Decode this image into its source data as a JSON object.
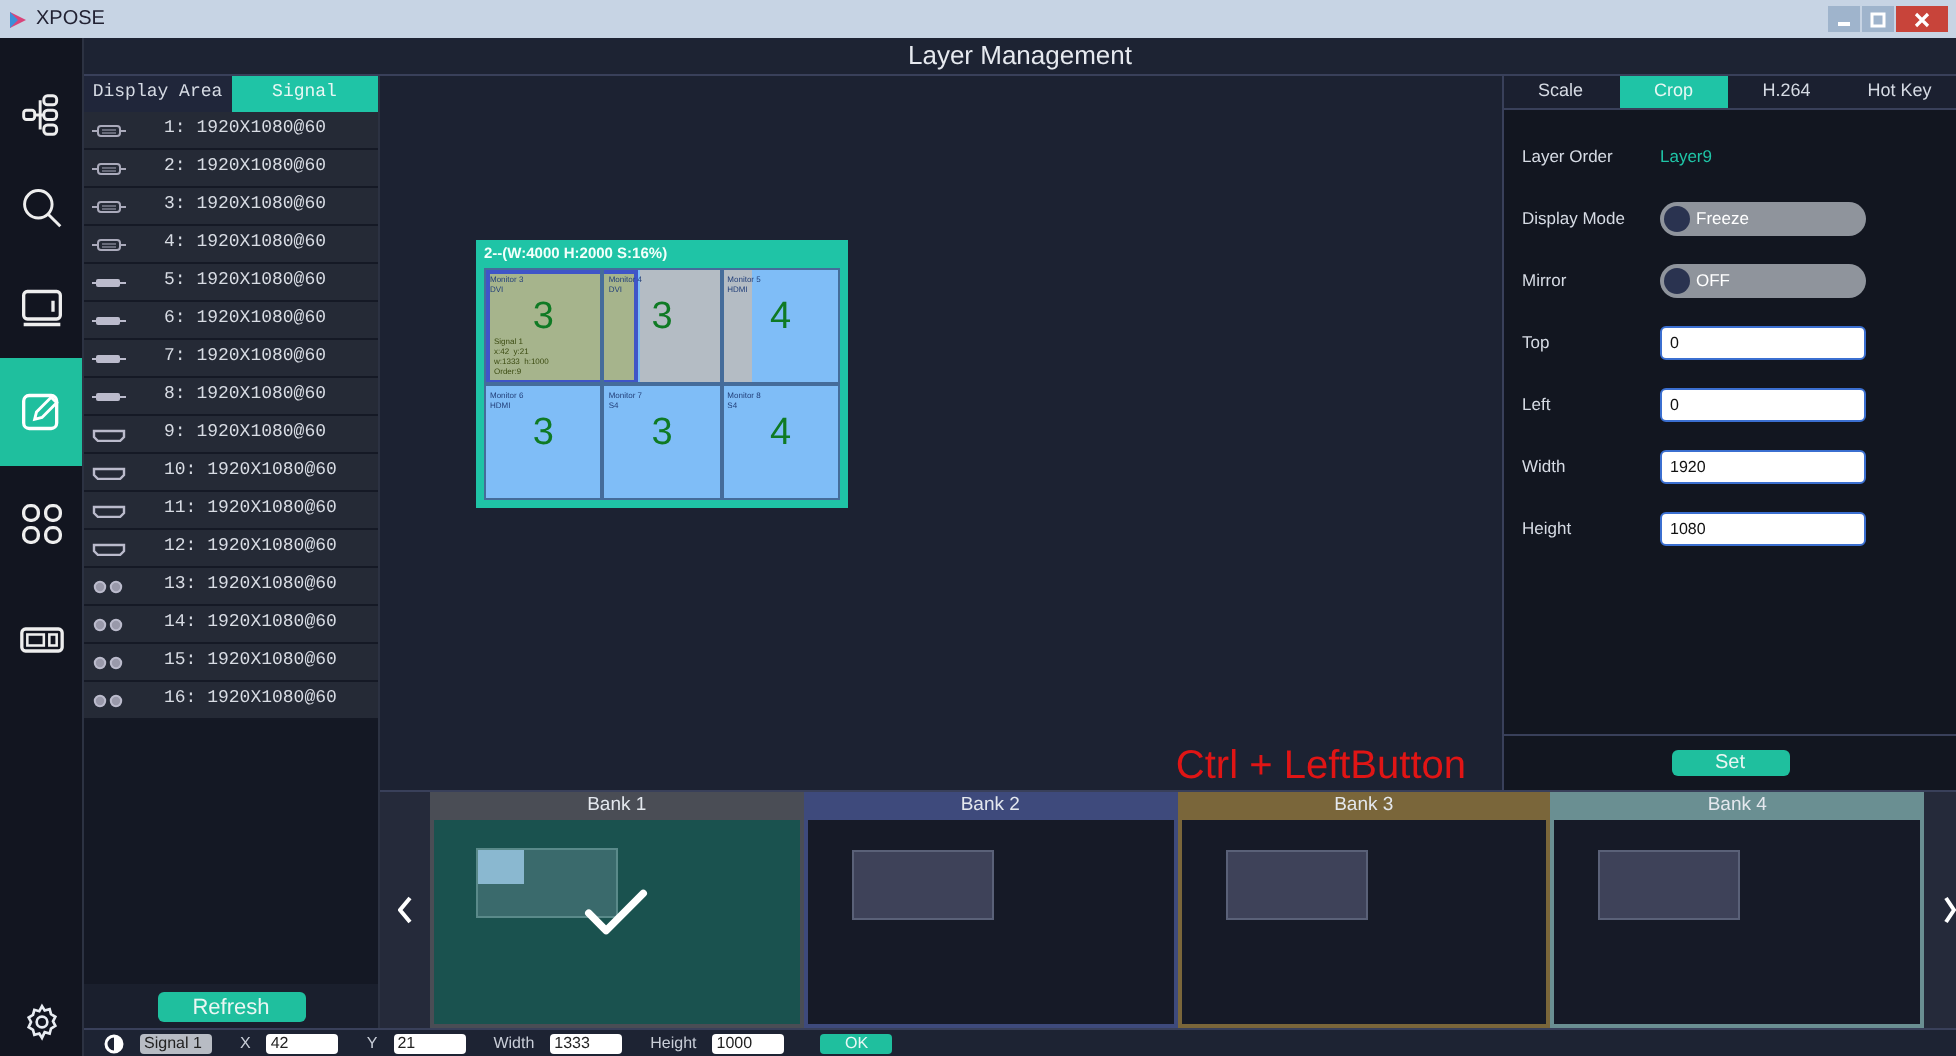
{
  "window": {
    "title": "XPOSE"
  },
  "nav": [
    {
      "kind": "tree",
      "selected": false
    },
    {
      "kind": "search",
      "selected": false
    },
    {
      "kind": "monitor",
      "selected": false
    },
    {
      "kind": "edit",
      "selected": true
    },
    {
      "kind": "grid",
      "selected": false
    },
    {
      "kind": "display",
      "selected": false
    }
  ],
  "header": "Layer Management",
  "signal_panel": {
    "tabs": [
      {
        "label": "Display Area",
        "selected": false
      },
      {
        "label": "Signal",
        "selected": true
      }
    ],
    "signals": [
      {
        "kind": "vga",
        "label": "1: 1920X1080@60"
      },
      {
        "kind": "vga",
        "label": "2: 1920X1080@60"
      },
      {
        "kind": "vga",
        "label": "3: 1920X1080@60"
      },
      {
        "kind": "vga",
        "label": "4: 1920X1080@60"
      },
      {
        "kind": "dvi",
        "label": "5: 1920X1080@60"
      },
      {
        "kind": "dvi",
        "label": "6: 1920X1080@60"
      },
      {
        "kind": "dvi",
        "label": "7: 1920X1080@60"
      },
      {
        "kind": "dvi",
        "label": "8: 1920X1080@60"
      },
      {
        "kind": "hdmi",
        "label": "9: 1920X1080@60"
      },
      {
        "kind": "hdmi",
        "label": "10: 1920X1080@60"
      },
      {
        "kind": "hdmi",
        "label": "11: 1920X1080@60"
      },
      {
        "kind": "hdmi",
        "label": "12: 1920X1080@60"
      },
      {
        "kind": "dual",
        "label": "13: 1920X1080@60"
      },
      {
        "kind": "dual",
        "label": "14: 1920X1080@60"
      },
      {
        "kind": "dual",
        "label": "15: 1920X1080@60"
      },
      {
        "kind": "dual",
        "label": "16: 1920X1080@60"
      }
    ],
    "refresh_button": "Refresh"
  },
  "screen": {
    "title": "2--(W:4000 H:2000 S:16%)",
    "cells": [
      {
        "monitor": "Monitor 3",
        "port": "DVI",
        "number": "3"
      },
      {
        "monitor": "Monitor 4",
        "port": "DVI",
        "number": "3"
      },
      {
        "monitor": "Monitor 5",
        "port": "HDMI",
        "number": "4"
      },
      {
        "monitor": "Monitor 6",
        "port": "HDMI",
        "number": "3"
      },
      {
        "monitor": "Monitor 7",
        "port": "S4",
        "number": "3"
      },
      {
        "monitor": "Monitor 8",
        "port": "S4",
        "number": "4"
      }
    ],
    "layer": {
      "lines": [
        "Signal 1",
        "x:42  y:21",
        "w:1333  h:1000",
        "Order:9"
      ],
      "selected": true
    }
  },
  "hint": "Ctrl + LeftButton",
  "properties": {
    "tabs": [
      {
        "label": "Scale",
        "selected": false
      },
      {
        "label": "Crop",
        "selected": true
      },
      {
        "label": "H.264",
        "selected": false
      },
      {
        "label": "Hot Key",
        "selected": false
      }
    ],
    "rows": [
      {
        "kind": "value",
        "label": "Layer Order",
        "value": "Layer9"
      },
      {
        "kind": "toggle",
        "label": "Display Mode",
        "value": "Freeze",
        "on": false
      },
      {
        "kind": "toggle",
        "label": "Mirror",
        "value": "OFF",
        "on": false
      },
      {
        "kind": "input",
        "label": "Top",
        "value": "0"
      },
      {
        "kind": "input",
        "label": "Left",
        "value": "0"
      },
      {
        "kind": "input",
        "label": "Width",
        "value": "1920"
      },
      {
        "kind": "input",
        "label": "Height",
        "value": "1080"
      }
    ],
    "set_button": "Set"
  },
  "banks": [
    {
      "label": "Bank 1",
      "color": "#4a4d55",
      "selected": true
    },
    {
      "label": "Bank 2",
      "color": "#3e4a7c",
      "selected": false
    },
    {
      "label": "Bank 3",
      "color": "#7a663a",
      "selected": false
    },
    {
      "label": "Bank 4",
      "color": "#6a8f92",
      "selected": false
    }
  ],
  "bottom_bar": {
    "signal": "Signal 1",
    "fields": [
      {
        "label": "X",
        "value": "42"
      },
      {
        "label": "Y",
        "value": "21"
      },
      {
        "label": "Width",
        "value": "1333"
      },
      {
        "label": "Height",
        "value": "1000"
      }
    ],
    "ok_button": "OK"
  }
}
